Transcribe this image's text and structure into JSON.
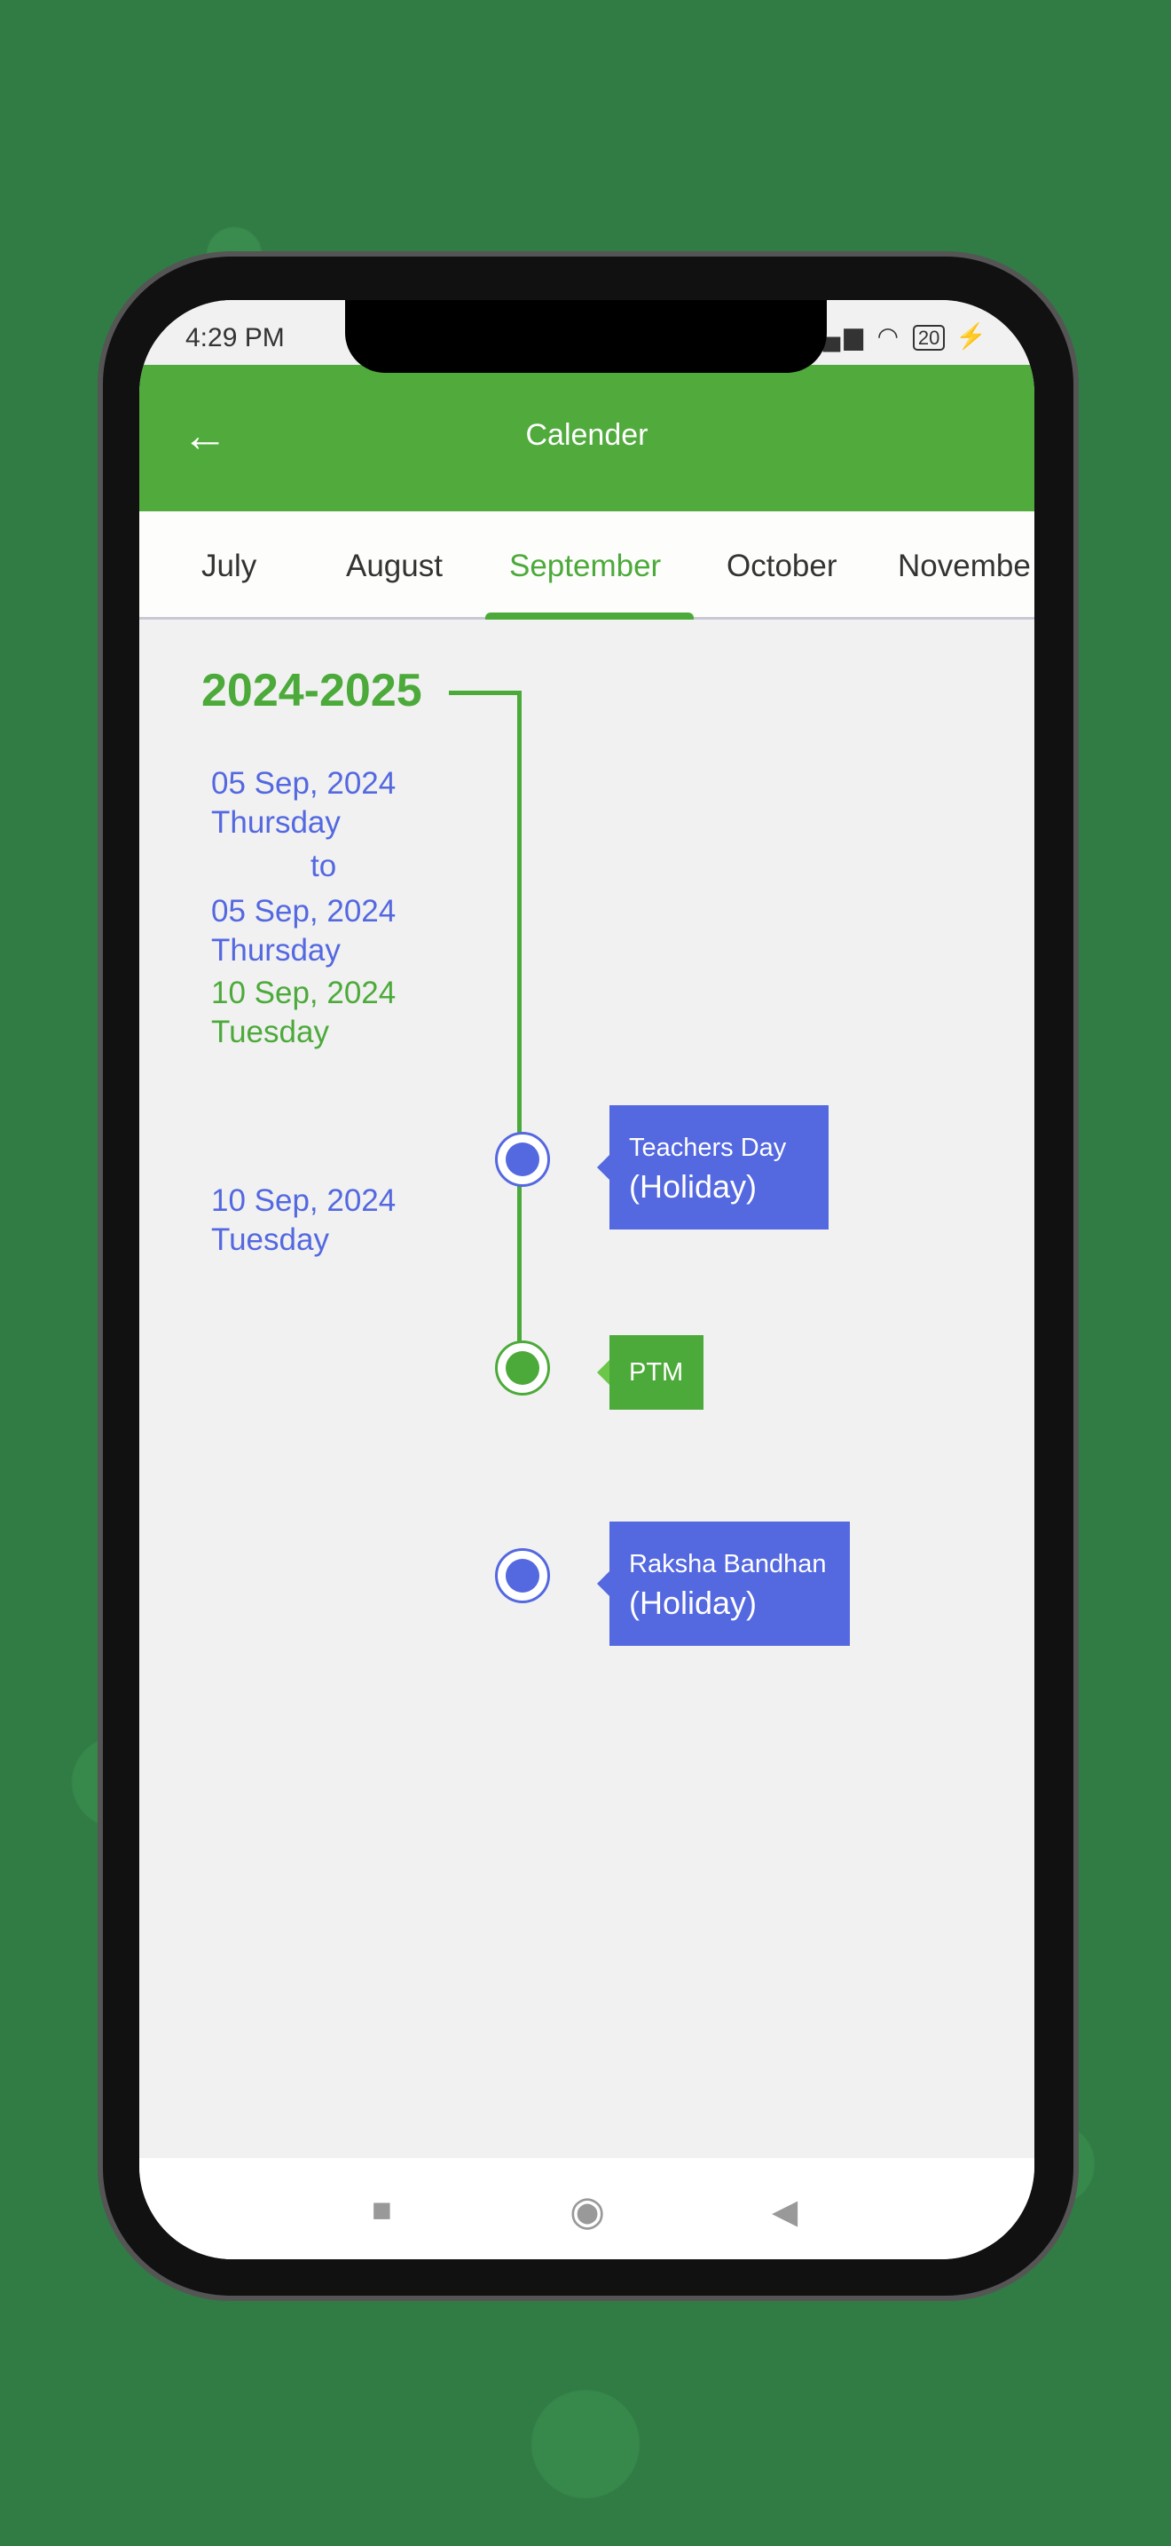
{
  "status_bar": {
    "time": "4:29 PM",
    "battery": "20"
  },
  "header": {
    "title": "Calender",
    "back_icon": "arrow-left-icon"
  },
  "tabs": [
    {
      "label": "July"
    },
    {
      "label": "August"
    },
    {
      "label": "September",
      "active": true
    },
    {
      "label": "October"
    },
    {
      "label": "Novembe"
    }
  ],
  "timeline": {
    "year": "2024-2025",
    "dates": [
      "05 Sep, 2024",
      "Thursday",
      "to",
      "05 Sep, 2024",
      "Thursday",
      "10 Sep, 2024",
      "Tuesday",
      "10 Sep, 2024",
      "Tuesday"
    ],
    "events": [
      {
        "title": "Teachers Day",
        "type": "(Holiday)",
        "color": "#5468e0"
      },
      {
        "title": "PTM",
        "type": "",
        "color": "#4caa3a"
      },
      {
        "title": "Raksha Bandhan",
        "type": "(Holiday)",
        "color": "#5468e0"
      }
    ]
  },
  "colors": {
    "accent": "#4caa3a",
    "holiday": "#5468e0"
  },
  "nav": {
    "icons": [
      "square-recents-icon",
      "circle-home-icon",
      "triangle-back-icon"
    ]
  }
}
